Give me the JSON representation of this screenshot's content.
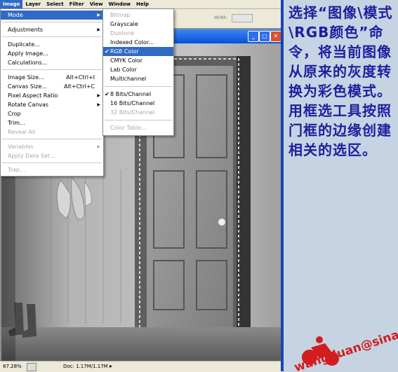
{
  "menubar": {
    "items": [
      "Image",
      "Layer",
      "Select",
      "Filter",
      "View",
      "Window",
      "Help"
    ]
  },
  "options_bar": {
    "width_label": "Width:"
  },
  "image_menu": {
    "items": [
      {
        "label": "Mode",
        "shortcut": "",
        "submenu": true,
        "state": "highlighted"
      },
      {
        "label": "Adjustments",
        "shortcut": "",
        "submenu": true,
        "state": "normal"
      },
      {
        "label": "Duplicate...",
        "shortcut": "",
        "submenu": false,
        "state": "normal"
      },
      {
        "label": "Apply Image...",
        "shortcut": "",
        "submenu": false,
        "state": "normal"
      },
      {
        "label": "Calculations...",
        "shortcut": "",
        "submenu": false,
        "state": "normal"
      },
      {
        "label": "Image Size...",
        "shortcut": "Alt+Ctrl+I",
        "submenu": false,
        "state": "normal"
      },
      {
        "label": "Canvas Size...",
        "shortcut": "Alt+Ctrl+C",
        "submenu": false,
        "state": "normal"
      },
      {
        "label": "Pixel Aspect Ratio",
        "shortcut": "",
        "submenu": true,
        "state": "normal"
      },
      {
        "label": "Rotate Canvas",
        "shortcut": "",
        "submenu": true,
        "state": "normal"
      },
      {
        "label": "Crop",
        "shortcut": "",
        "submenu": false,
        "state": "normal"
      },
      {
        "label": "Trim...",
        "shortcut": "",
        "submenu": false,
        "state": "normal"
      },
      {
        "label": "Reveal All",
        "shortcut": "",
        "submenu": false,
        "state": "disabled"
      },
      {
        "label": "Variables",
        "shortcut": "",
        "submenu": true,
        "state": "disabled"
      },
      {
        "label": "Apply Data Set...",
        "shortcut": "",
        "submenu": false,
        "state": "disabled"
      },
      {
        "label": "Trap...",
        "shortcut": "",
        "submenu": false,
        "state": "disabled"
      }
    ]
  },
  "mode_menu": {
    "items": [
      {
        "label": "Bitmap",
        "state": "disabled",
        "checked": false
      },
      {
        "label": "Grayscale",
        "state": "normal",
        "checked": false
      },
      {
        "label": "Duotone",
        "state": "disabled",
        "checked": false
      },
      {
        "label": "Indexed Color...",
        "state": "normal",
        "checked": false
      },
      {
        "label": "RGB Color",
        "state": "highlighted",
        "checked": true
      },
      {
        "label": "CMYK Color",
        "state": "normal",
        "checked": false
      },
      {
        "label": "Lab Color",
        "state": "normal",
        "checked": false
      },
      {
        "label": "Multichannel",
        "state": "normal",
        "checked": false
      },
      {
        "label": "8 Bits/Channel",
        "state": "normal",
        "checked": true
      },
      {
        "label": "16 Bits/Channel",
        "state": "normal",
        "checked": false
      },
      {
        "label": "32 Bits/Channel",
        "state": "disabled",
        "checked": false
      },
      {
        "label": "Color Table...",
        "state": "disabled",
        "checked": false
      }
    ]
  },
  "window": {
    "buttons": [
      "minimize",
      "maximize",
      "close"
    ]
  },
  "status_bar": {
    "zoom": "87.28%",
    "doc_info": "Doc: 1.17M/1.17M"
  },
  "annotation": {
    "paragraph1": "选择“图像\\模式\\RGB颜色”命令，将当前图像从原来的灰度转换为彩色模式。",
    "paragraph2": "用框选工具按照门框的边缘创建相关的选区。"
  },
  "watermark": {
    "text": "wangduan@sina.com"
  },
  "colors": {
    "menu_highlight": "#316ac5",
    "annotation_text": "#1d1f9e",
    "background": "#c6d3e3",
    "title_bar": "#0a4fd8"
  }
}
